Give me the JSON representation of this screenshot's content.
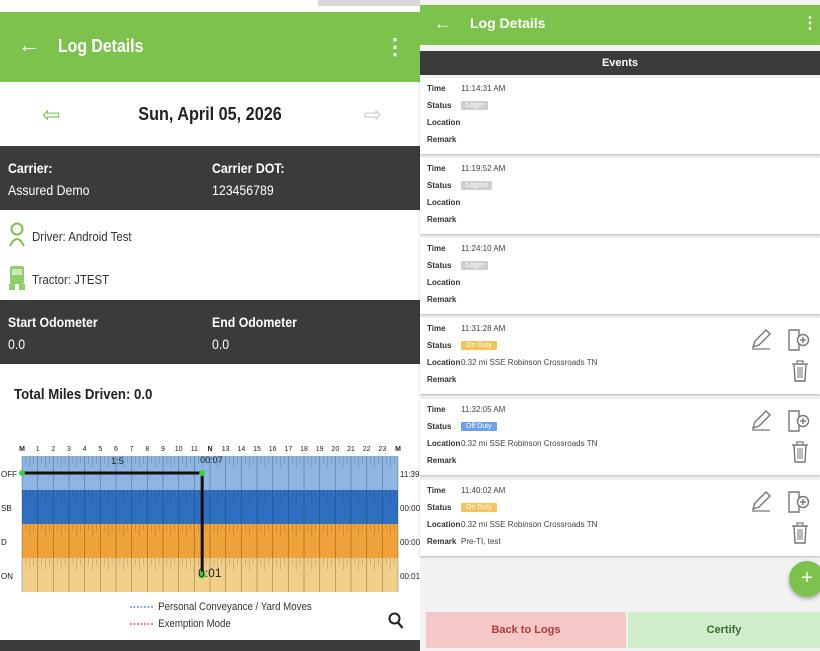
{
  "left": {
    "appbar": {
      "title": "Log Details",
      "back_icon": "arrow-left-icon",
      "menu_icon": "more-vert-icon"
    },
    "date": "Sun, April 05, 2026",
    "carrier": {
      "label": "Carrier:",
      "value": "Assured Demo"
    },
    "carrier_dot": {
      "label": "Carrier DOT:",
      "value": "123456789"
    },
    "driver": "Driver:  Android Test",
    "tractor": "Tractor:  JTEST",
    "start_odometer": {
      "label": "Start Odometer",
      "value": "0.0"
    },
    "end_odometer": {
      "label": "End Odometer",
      "value": "0.0"
    },
    "total_miles": "Total Miles Driven:  0.0",
    "graph": {
      "hours": [
        "M",
        "1",
        "2",
        "3",
        "4",
        "5",
        "6",
        "7",
        "8",
        "9",
        "10",
        "11",
        "N",
        "13",
        "14",
        "15",
        "16",
        "17",
        "18",
        "19",
        "20",
        "21",
        "22",
        "23",
        "M"
      ],
      "rows": [
        {
          "label": "OFF",
          "total": "11:39",
          "color": "#8fb6e3"
        },
        {
          "label": "SB",
          "total": "00:00",
          "color": "#2f6fc2"
        },
        {
          "label": "D",
          "total": "00:00",
          "color": "#f0a33a"
        },
        {
          "label": "ON",
          "total": "00:01",
          "color": "#f2cf88"
        }
      ],
      "overlay_top": "00:07",
      "overlay_left": "1:5",
      "overlay_bottom": "0:01"
    },
    "legend": {
      "pc": "Personal Conveyance / Yard Moves",
      "exempt": "Exemption Mode"
    }
  },
  "right": {
    "appbar": {
      "title": "Log Details"
    },
    "events_header": "Events",
    "labels": {
      "time": "Time",
      "status": "Status",
      "location": "Location",
      "remark": "Remark"
    },
    "events": [
      {
        "time": "11:14:31 AM",
        "status": "Login",
        "status_color": "#cfcfcf",
        "location": "",
        "remark": "",
        "editable": false
      },
      {
        "time": "11:19:52 AM",
        "status": "Logout",
        "status_color": "#cfcfcf",
        "location": "",
        "remark": "",
        "editable": false
      },
      {
        "time": "11:24:10 AM",
        "status": "Login",
        "status_color": "#cfcfcf",
        "location": "",
        "remark": "",
        "editable": false
      },
      {
        "time": "11:31:28 AM",
        "status": "On Duty",
        "status_color": "#f5c35a",
        "location": "0.32 mi SSE Robinson Crossroads TN",
        "remark": "",
        "editable": true
      },
      {
        "time": "11:32:05 AM",
        "status": "Off Duty",
        "status_color": "#6f9fe8",
        "location": "0.32 mi SSE Robinson Crossroads TN",
        "remark": "",
        "editable": true
      },
      {
        "time": "11:40:02 AM",
        "status": "On Duty",
        "status_color": "#f5c35a",
        "location": "0.32 mi SSE Robinson Crossroads TN",
        "remark": "Pre-TI, test",
        "editable": true
      }
    ],
    "fab_label": "+",
    "back_button": "Back to Logs",
    "certify_button": "Certify"
  },
  "colors": {
    "accent": "#7cc24d",
    "dark_band": "#3b3b3b"
  }
}
